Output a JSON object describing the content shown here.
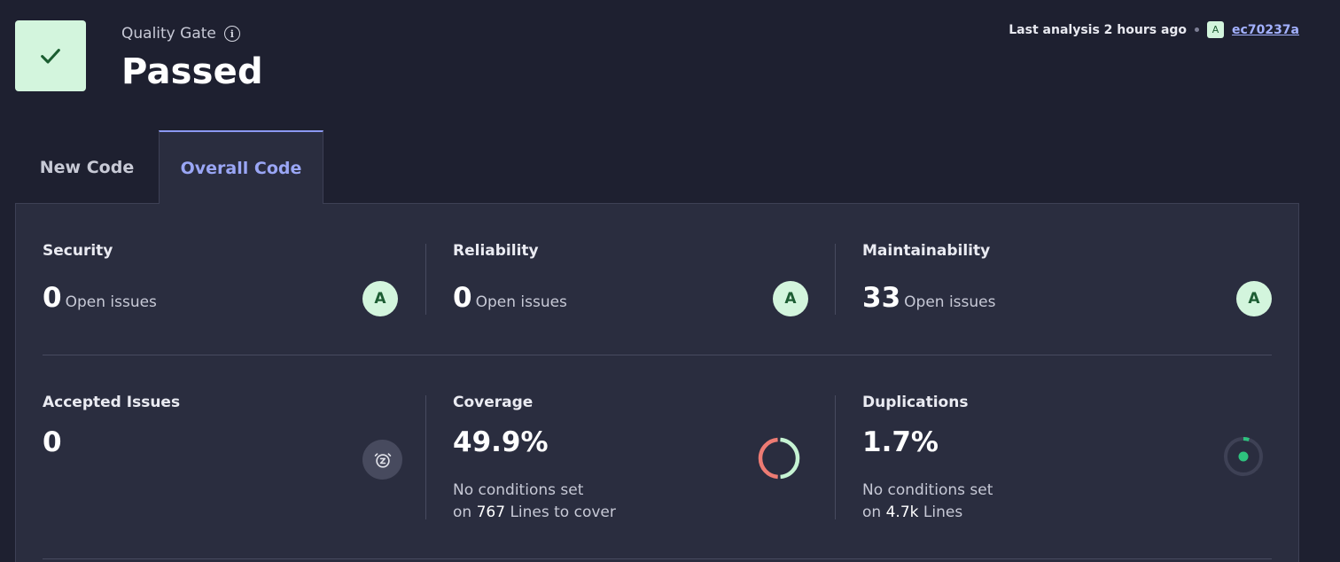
{
  "quality_gate": {
    "label": "Quality Gate",
    "status": "Passed",
    "status_color": "#d3f5dd",
    "check_icon": "check-icon",
    "info_icon": "info-icon"
  },
  "analysis": {
    "prefix": "Last analysis",
    "when": "2 hours ago",
    "commit_rating": "A",
    "commit_hash": "ec70237a"
  },
  "tabs": [
    {
      "label": "New Code",
      "active": false
    },
    {
      "label": "Overall Code",
      "active": true
    }
  ],
  "metrics": {
    "security": {
      "title": "Security",
      "value": "0",
      "suffix": "Open issues",
      "rating": "A"
    },
    "reliability": {
      "title": "Reliability",
      "value": "0",
      "suffix": "Open issues",
      "rating": "A"
    },
    "maintainability": {
      "title": "Maintainability",
      "value": "33",
      "suffix": "Open issues",
      "rating": "A"
    },
    "accepted": {
      "title": "Accepted Issues",
      "value": "0",
      "icon": "snooze-icon"
    },
    "coverage": {
      "title": "Coverage",
      "value": "49.9%",
      "percent": 49.9,
      "note": "No conditions set",
      "on": "on",
      "count": "767",
      "unit": "Lines to cover"
    },
    "duplications": {
      "title": "Duplications",
      "value": "1.7%",
      "percent": 1.7,
      "note": "No conditions set",
      "on": "on",
      "count": "4.7k",
      "unit": "Lines"
    }
  },
  "colors": {
    "background": "#1e2030",
    "panel": "#2a2d3f",
    "accent": "#8b98f2",
    "rating_bg": "#d3f5dd",
    "coverage_covered": "#c6f3d3",
    "coverage_uncovered": "#ed7b73",
    "duplication_dot": "#2ec27e"
  }
}
